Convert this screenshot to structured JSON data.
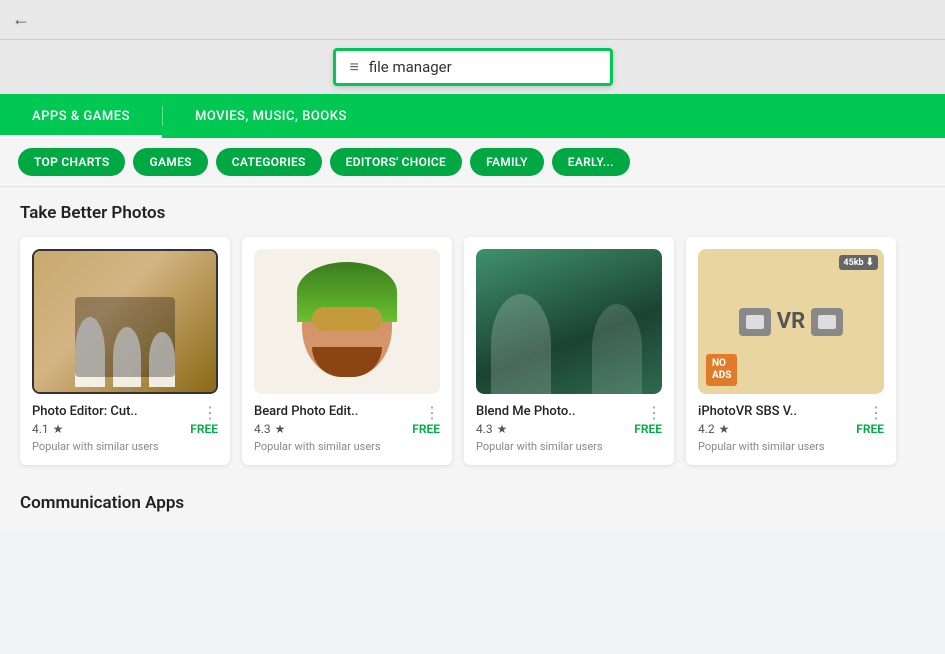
{
  "browser": {
    "back_icon": "←"
  },
  "search": {
    "menu_icon": "≡",
    "query": "file manager"
  },
  "nav": {
    "tabs": [
      {
        "label": "APPS & GAMES",
        "active": true
      },
      {
        "label": "MOVIES, MUSIC, BOOKS",
        "active": false
      }
    ]
  },
  "pills": [
    {
      "label": "TOP CHARTS"
    },
    {
      "label": "GAMES"
    },
    {
      "label": "CATEGORIES"
    },
    {
      "label": "EDITORS' CHOICE"
    },
    {
      "label": "FAMILY"
    },
    {
      "label": "EARLY..."
    }
  ],
  "sections": [
    {
      "title": "Take Better Photos",
      "apps": [
        {
          "name": "Photo Editor: Cut..",
          "rating": "4.1",
          "price": "FREE",
          "subtitle": "Popular with similar users",
          "thumb_type": "photo-editor"
        },
        {
          "name": "Beard Photo Edit..",
          "rating": "4.3",
          "price": "FREE",
          "subtitle": "Popular with similar users",
          "thumb_type": "beard"
        },
        {
          "name": "Blend Me Photo..",
          "rating": "4.3",
          "price": "FREE",
          "subtitle": "Popular with similar users",
          "thumb_type": "blend"
        },
        {
          "name": "iPhotoVR SBS V..",
          "rating": "4.2",
          "price": "FREE",
          "subtitle": "Popular with similar users",
          "thumb_type": "iphoto",
          "badge": "45kb"
        }
      ]
    }
  ],
  "communication_section": {
    "title": "Communication Apps"
  },
  "colors": {
    "green": "#00c853",
    "dark_green": "#00a844",
    "free": "#00a844"
  }
}
